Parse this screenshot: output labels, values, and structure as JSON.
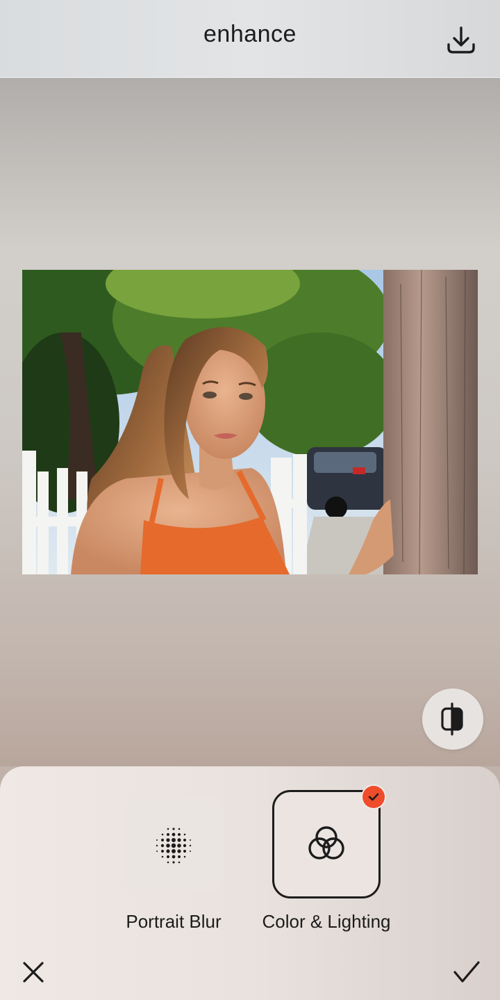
{
  "header": {
    "title": "enhance",
    "download_icon": "download-icon"
  },
  "preview": {
    "image_description_icon": "photo",
    "compare_icon": "split-compare-icon"
  },
  "tools": [
    {
      "label": "Portrait Blur",
      "icon": "dots-grid-icon",
      "selected": false
    },
    {
      "label": "Color & Lighting",
      "icon": "overlapping-circles-icon",
      "selected": true
    }
  ],
  "footer": {
    "cancel_icon": "close-icon",
    "confirm_icon": "check-icon"
  },
  "colors": {
    "accent_badge": "#ef4c2c",
    "selected_border": "#1c1c1c"
  }
}
